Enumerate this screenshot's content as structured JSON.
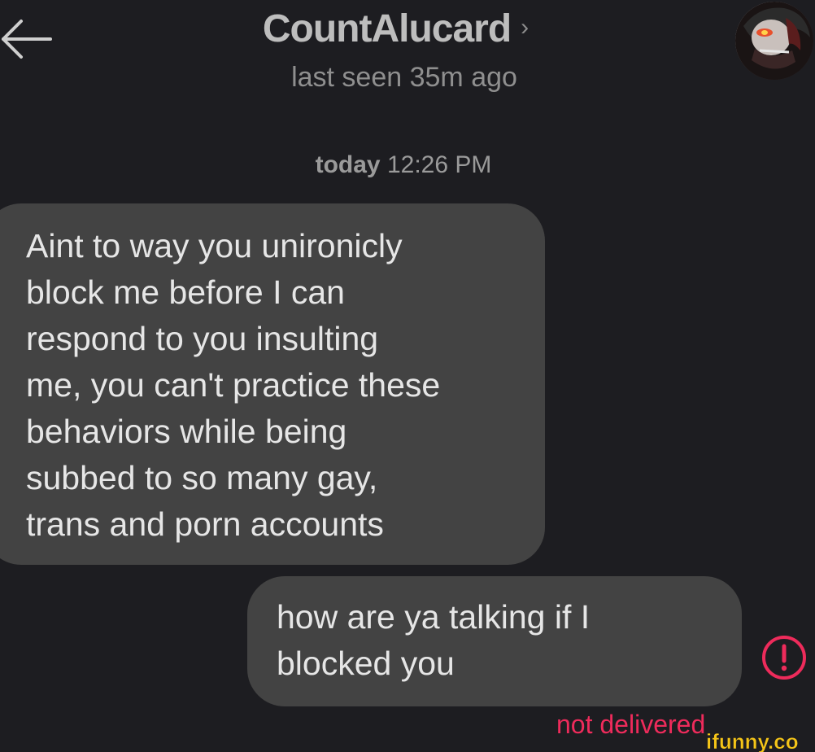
{
  "header": {
    "contact_name": "CountAlucard",
    "chevron": "›",
    "last_seen": "last seen 35m ago",
    "back_icon": "arrow-left-icon",
    "avatar_icon": "profile-avatar"
  },
  "date_divider": {
    "day": "today",
    "time": "12:26 PM"
  },
  "messages": [
    {
      "direction": "incoming",
      "text": "Aint to way you unironicly\nblock me before I can\nrespond to you insulting\nme, you can't practice these\nbehaviors while being\nsubbed to so many gay,\ntrans and porn accounts"
    },
    {
      "direction": "outgoing",
      "text": "how are ya talking if I\nblocked you",
      "status": "not delivered",
      "status_icon": "exclamation-circle-icon"
    }
  ],
  "watermark": {
    "text": "ifunny.co"
  },
  "colors": {
    "background": "#1d1d21",
    "bubble": "#434343",
    "error": "#ee2b5b",
    "watermark": "#f5c518"
  }
}
